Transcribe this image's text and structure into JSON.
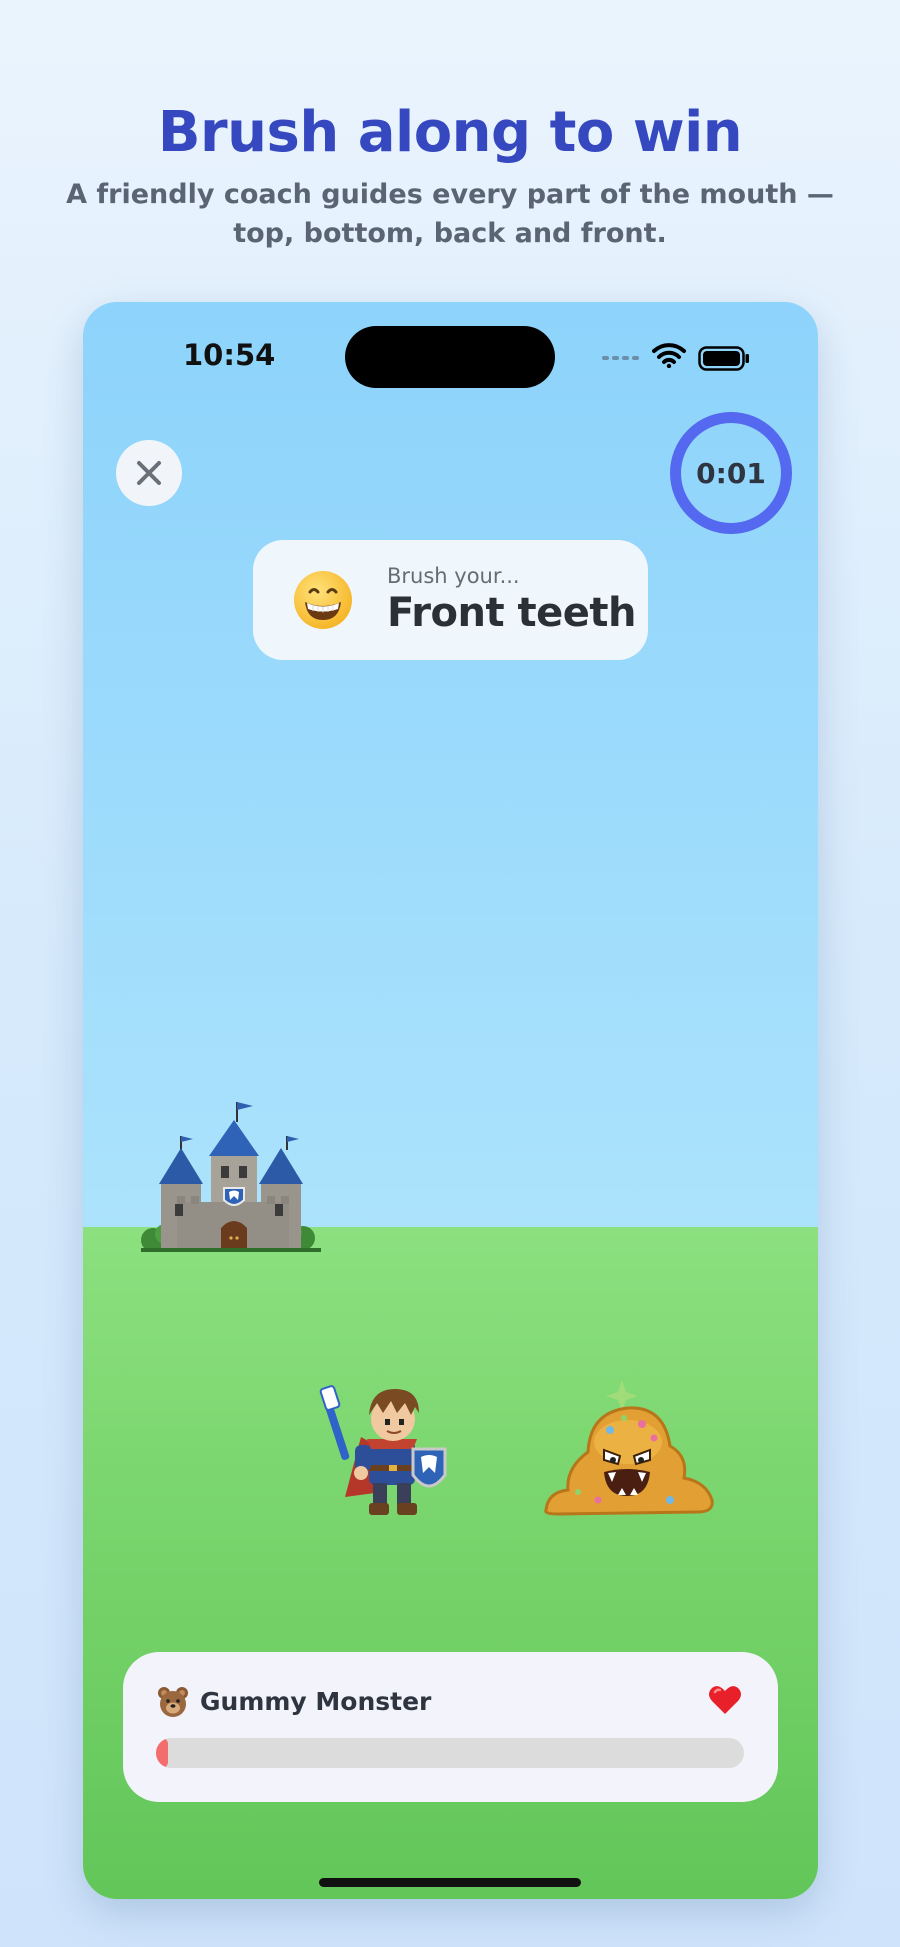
{
  "header": {
    "title": "Brush along to win",
    "subtitle": "A friendly coach guides every part of the mouth — top, bottom, back and front."
  },
  "status_bar": {
    "time": "10:54",
    "icons": [
      "signal-dots-icon",
      "wifi-icon",
      "battery-icon"
    ]
  },
  "game": {
    "close_icon": "close-icon",
    "timer": "0:01",
    "prompt": {
      "emoji_icon": "grinning-face-icon",
      "label": "Brush your...",
      "area": "Front teeth"
    },
    "scene": {
      "castle": "castle-icon",
      "hero": "toothbrush-knight-icon",
      "enemy": "gummy-monster-icon"
    },
    "enemy_card": {
      "icon": "bear-icon",
      "name": "Gummy Monster",
      "heart_icon": "heart-icon",
      "health_fraction": 0.02
    }
  },
  "colors": {
    "title": "#3548c0",
    "timer_ring": "#5568f0",
    "health_fill": "#f36d6d",
    "sky": "#8dd3fb",
    "grass": "#78d46c"
  }
}
